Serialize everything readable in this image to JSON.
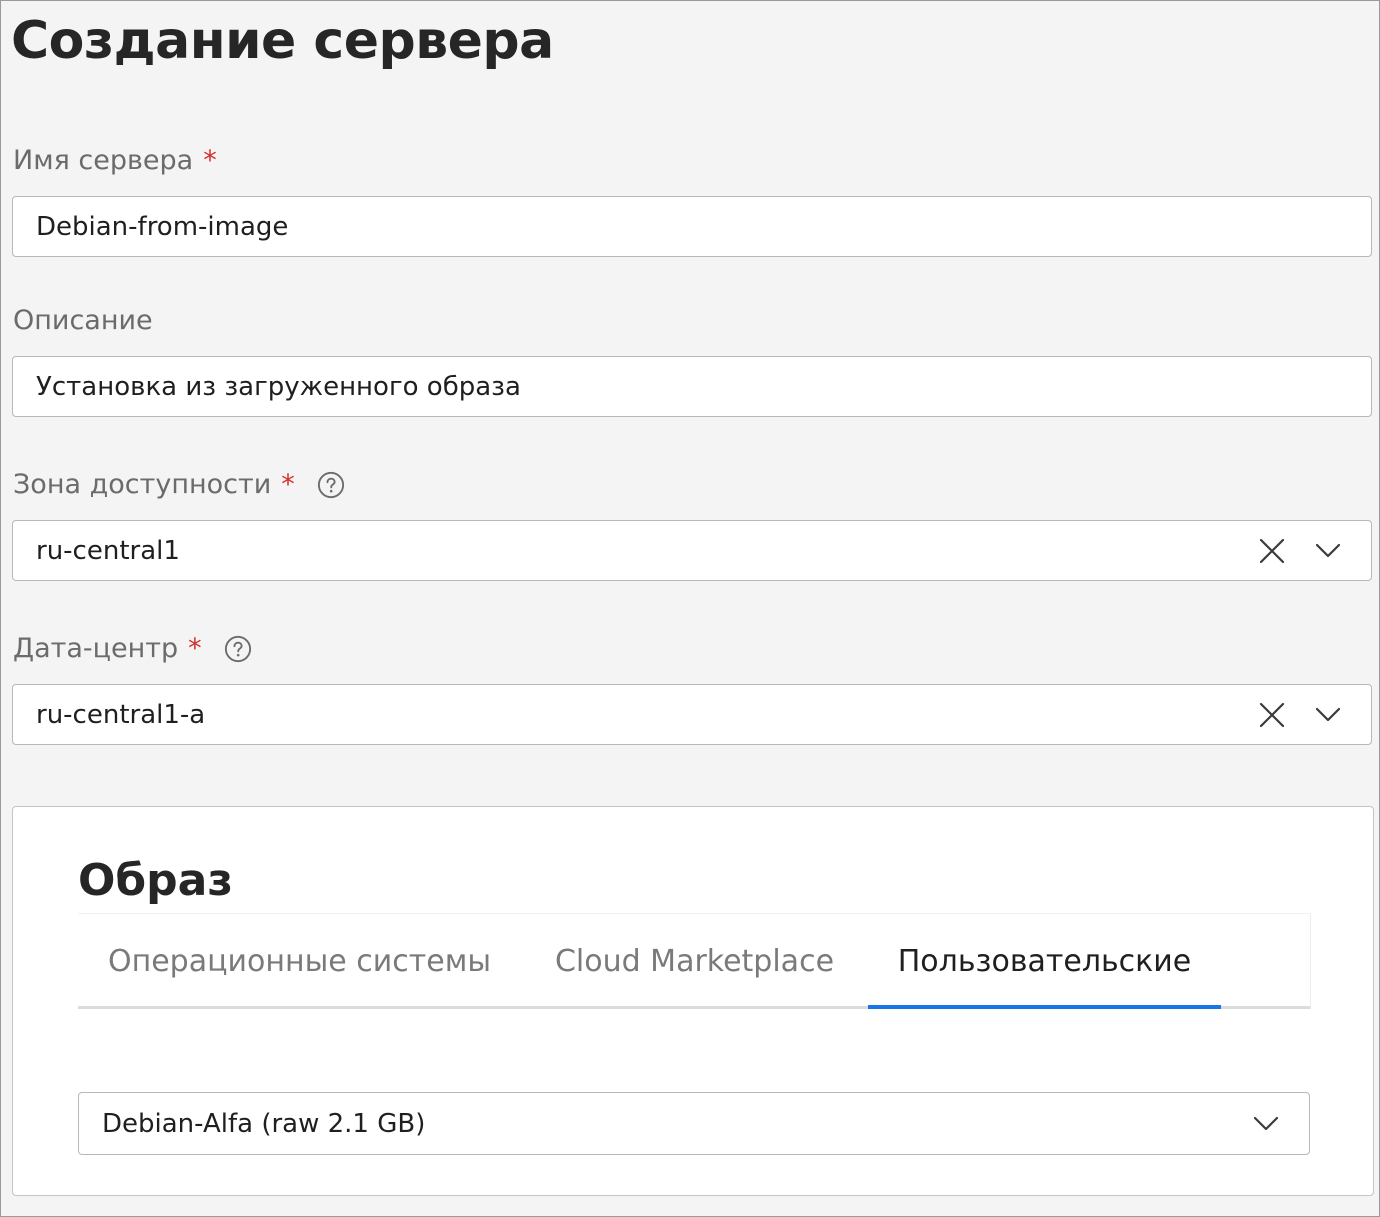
{
  "page": {
    "title": "Создание сервера"
  },
  "form": {
    "required_marker": "*",
    "server_name": {
      "label": "Имя сервера",
      "value": "Debian-from-image"
    },
    "description": {
      "label": "Описание",
      "value": "Установка из загруженного образа"
    },
    "availability_zone": {
      "label": "Зона доступности",
      "value": "ru-central1"
    },
    "datacenter": {
      "label": "Дата-центр",
      "value": "ru-central1-a"
    }
  },
  "image_section": {
    "title": "Образ",
    "tabs": [
      {
        "label": "Операционные системы",
        "active": false
      },
      {
        "label": "Cloud Marketplace",
        "active": false
      },
      {
        "label": "Пользовательские",
        "active": true
      }
    ],
    "selected_image": "Debian-Alfa (raw 2.1 GB)"
  },
  "icons": {
    "help": "help-circle-icon",
    "clear": "close-icon",
    "expand": "chevron-down-icon"
  },
  "colors": {
    "background": "#f4f4f4",
    "required": "#d32f2f",
    "active_tab_indicator": "#1976e8",
    "muted_text": "#6b6b6b"
  }
}
